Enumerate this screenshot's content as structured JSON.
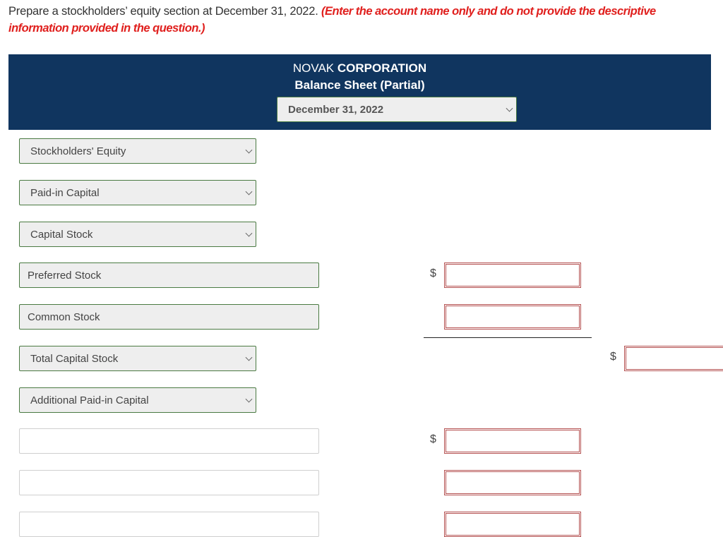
{
  "instructions": {
    "text": "Prepare a stockholders’ equity section at December 31, 2022.",
    "note": "(Enter the account name only and do not provide the descriptive information provided in the question.)"
  },
  "header": {
    "company_normal": "NOVAK",
    "company_bold": "CORPORATION",
    "statement": "Balance Sheet (Partial)",
    "date_select": "December 31, 2022"
  },
  "rows": [
    {
      "label": "Stockholders' Equity",
      "type": "select"
    },
    {
      "label": "Paid-in Capital",
      "type": "select"
    },
    {
      "label": "Capital Stock",
      "type": "select"
    },
    {
      "label": "Preferred Stock",
      "type": "text",
      "col1_value": "",
      "currency": "$"
    },
    {
      "label": "Common Stock",
      "type": "text",
      "col1_value": ""
    },
    {
      "label": "Total Capital Stock",
      "type": "select",
      "col2_value": "",
      "currency": "$"
    },
    {
      "label": "Additional Paid-in Capital",
      "type": "select"
    },
    {
      "label": "",
      "type": "text",
      "col1_value": "",
      "currency": "$"
    },
    {
      "label": "",
      "type": "text",
      "col1_value": ""
    },
    {
      "label": "",
      "type": "text",
      "col1_value": ""
    }
  ],
  "icons": {
    "dropdown": "chevron-down-icon"
  }
}
